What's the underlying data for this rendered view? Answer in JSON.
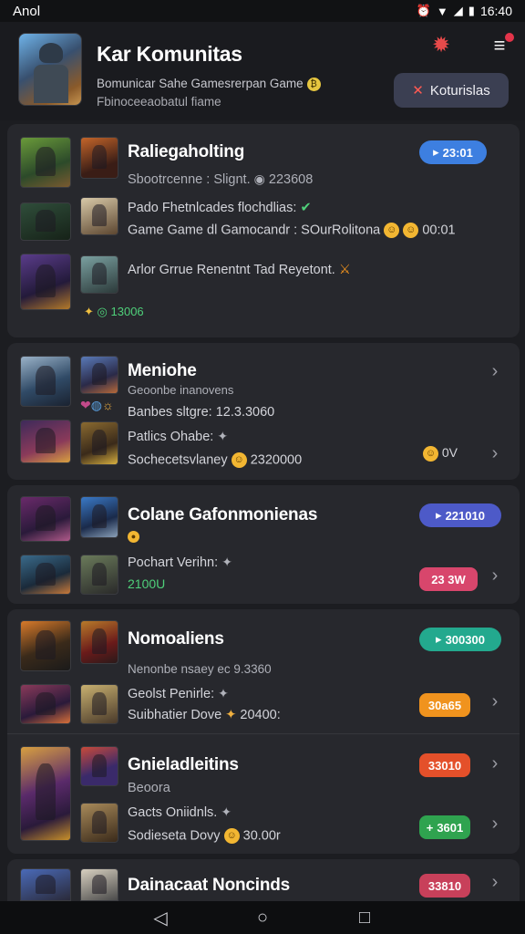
{
  "status": {
    "carrier": "Anol",
    "time": "16:40"
  },
  "header": {
    "title": "Kar Komunitas",
    "subtitle1": "Bomunicar Sahe Gamesrerpan Game",
    "subtitle2": "Fbinoceeaobatul fiame",
    "button_label": "Koturislas"
  },
  "colors": {
    "blue": "#3d7fe0",
    "indigo": "#4d5ac8",
    "pink": "#d8466c",
    "teal": "#23a98e",
    "orange": "#f0931e",
    "red": "#e4502a",
    "green": "#2fa34f",
    "rose": "#c8405a"
  },
  "groups": [
    {
      "title": "Raliegaholting",
      "badge": "23:01",
      "lines": [
        "Sbootrcenne : Slignt.",
        "Pado Fhetnlcades flochdlias:",
        "Game Game dl Gamocandr : SOurRolitona",
        "Arlor Grrue Renentnt Tad Reyetont."
      ],
      "stat1": "223608",
      "time": "00:01",
      "footer": "13006"
    },
    {
      "title": "Meniohe",
      "lines": [
        "Geoonbe inanovens",
        "Banbes sltgre: 12.3.3060",
        "Patlics Ohabe:",
        "Sochecetsvlaney"
      ],
      "stat": "2320000",
      "right_label": "0V"
    },
    {
      "title": "Colane Gafonmonienas",
      "badge": "221010",
      "lines": [
        "Pochart Verihn:"
      ],
      "green_stat": "2100U",
      "pill": "23 3W"
    },
    {
      "title": "Nomoaliens",
      "badge": "300300",
      "lines": [
        "Nenonbe nsaey ec 9.3360",
        "Geolst Penirle:",
        "Suibhatier Dove"
      ],
      "stat": "20400:",
      "pill": "30a65"
    },
    {
      "title": "Gnieladleitins",
      "lines": [
        "Beoora",
        "Gacts Oniidnls.",
        "Sodieseta Dovy"
      ],
      "stat": "30.00r",
      "pill1": "33010",
      "pill2": "3601"
    },
    {
      "title": "Dainacaat Noncinds",
      "pill": "33810"
    }
  ]
}
